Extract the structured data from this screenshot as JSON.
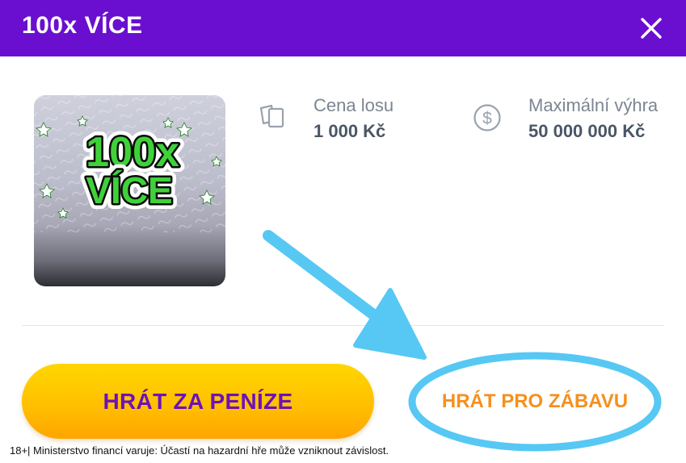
{
  "header": {
    "title": "100x VÍCE",
    "background_color": "#6a0fcf"
  },
  "ticket": {
    "logo_line1": "100x",
    "logo_line2": "VÍCE"
  },
  "info": {
    "price": {
      "icon": "tickets-icon",
      "label": "Cena losu",
      "value": "1 000 Kč"
    },
    "max_win": {
      "icon": "dollar-circle-icon",
      "label": "Maximální výhra",
      "value": "50 000 000 Kč"
    }
  },
  "actions": {
    "play_money": "HRÁT ZA PENÍZE",
    "play_fun": "HRÁT PRO ZÁBAVU"
  },
  "annotation": {
    "color": "#56c8f3",
    "shapes": [
      "arrow",
      "ellipse"
    ]
  },
  "colors": {
    "accent_purple": "#6d12b8",
    "button_yellow": "#ffc000",
    "fun_orange": "#f5901e",
    "text_gray": "#4a5665"
  },
  "disclaimer": "18+| Ministerstvo financí varuje: Účastí na hazardní hře může vzniknout závislost."
}
